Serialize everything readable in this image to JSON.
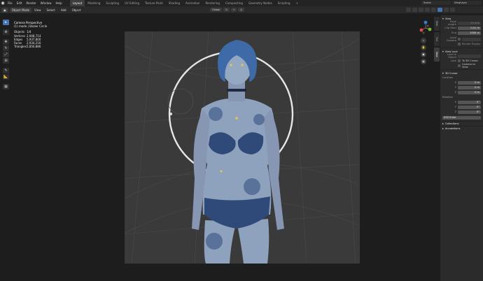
{
  "topbar": {
    "menus": [
      "File",
      "Edit",
      "Render",
      "Window",
      "Help"
    ],
    "workspaces": [
      "Layout",
      "Modeling",
      "Sculpting",
      "UV Editing",
      "Texture Paint",
      "Shading",
      "Animation",
      "Rendering",
      "Compositing",
      "Geometry Nodes",
      "Scripting"
    ],
    "active_workspace": "Layout",
    "add_tab": "+",
    "scene_label": "Scene",
    "view_layer_label": "ViewLayer"
  },
  "viewport_header": {
    "mode": "Object Mode",
    "menus": [
      "View",
      "Select",
      "Add",
      "Object"
    ],
    "orientation": "Global"
  },
  "overlay": {
    "title": "Camera Perspective",
    "subtitle": "(1) mode | Bezier Circle",
    "stats": [
      {
        "label": "Objects",
        "value": "1/4"
      },
      {
        "label": "Vertices",
        "value": "2,948,714"
      },
      {
        "label": "Edges",
        "value": "5,937,800"
      },
      {
        "label": "Faces",
        "value": "2,934,216"
      },
      {
        "label": "Triangles",
        "value": "5,856,886"
      }
    ]
  },
  "npanel": {
    "tabs": [
      "Item",
      "Tool",
      "View"
    ],
    "active_tab": "View",
    "view": {
      "header": "View",
      "focal_label": "Focal Length",
      "focal_value": "50 mm",
      "clip_start_label": "Clip Start",
      "clip_start_value": "0.01 m",
      "clip_end_label": "End",
      "clip_end_value": "1000 m",
      "local_camera_label": "Local Camera",
      "render_region_label": "Render Region"
    },
    "view_lock": {
      "header": "View Lock",
      "lock_to_object_label": "Lock to Object",
      "lock_label": "Lock",
      "lock_3d_cursor": "To 3D Cursor",
      "camera_to_view": "Camera to View"
    },
    "cursor": {
      "header": "3D Cursor",
      "location_label": "Location",
      "location": [
        {
          "axis": "X",
          "value": "0 m"
        },
        {
          "axis": "Y",
          "value": "0 m"
        },
        {
          "axis": "Z",
          "value": "0 m"
        }
      ],
      "rotation_label": "Rotation",
      "rotation": [
        {
          "axis": "X",
          "value": "0°"
        },
        {
          "axis": "Y",
          "value": "0°"
        },
        {
          "axis": "Z",
          "value": "0°"
        }
      ],
      "rotation_mode": "XYZ Euler"
    },
    "collections_header": "Collections",
    "annotations_header": "Annotations"
  },
  "gizmo": {
    "x": "X",
    "y": "Y",
    "z": "Z"
  },
  "colors": {
    "accent": "#4772b3",
    "axis_x": "#e04a5a",
    "axis_y": "#7fb834",
    "axis_z": "#3a7bd5",
    "skin": "#8fa2bd",
    "hair": "#3f6aa8",
    "canvas": "#3a3a3a"
  }
}
